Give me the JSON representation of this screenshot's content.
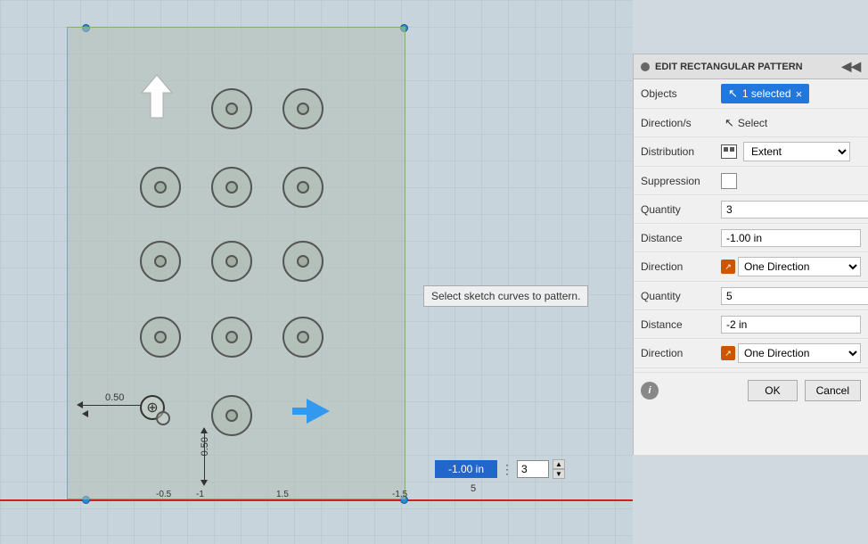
{
  "canvas": {
    "tooltip": "Select sketch curves to pattern."
  },
  "dimensions": {
    "horiz": "0.50",
    "vert": "0.50"
  },
  "panel": {
    "title": "EDIT RECTANGULAR PATTERN",
    "objects_label": "Objects",
    "selected_count": "1 selected",
    "close_badge": "×",
    "directions_label": "Direction/s",
    "select_btn": "Select",
    "distribution_label": "Distribution",
    "extent_value": "Extent",
    "suppression_label": "Suppression",
    "quantity1_label": "Quantity",
    "quantity1_value": "3",
    "distance1_label": "Distance",
    "distance1_value": "-1.00 in",
    "direction1_label": "Direction",
    "direction1_value": "One Direction",
    "quantity2_label": "Quantity",
    "quantity2_value": "5",
    "distance2_label": "Distance",
    "distance2_value": "-2 in",
    "direction2_label": "Direction",
    "direction2_value": "One Direction",
    "ok_label": "OK",
    "cancel_label": "Cancel",
    "info_icon": "i"
  },
  "bottom_input": {
    "distance_value": "-1.00 in",
    "quantity_value": "3",
    "label": "5"
  },
  "icons": {
    "cursor": "↖",
    "collapse": "◀◀",
    "minus": "−",
    "arrow_icon": "↗"
  }
}
